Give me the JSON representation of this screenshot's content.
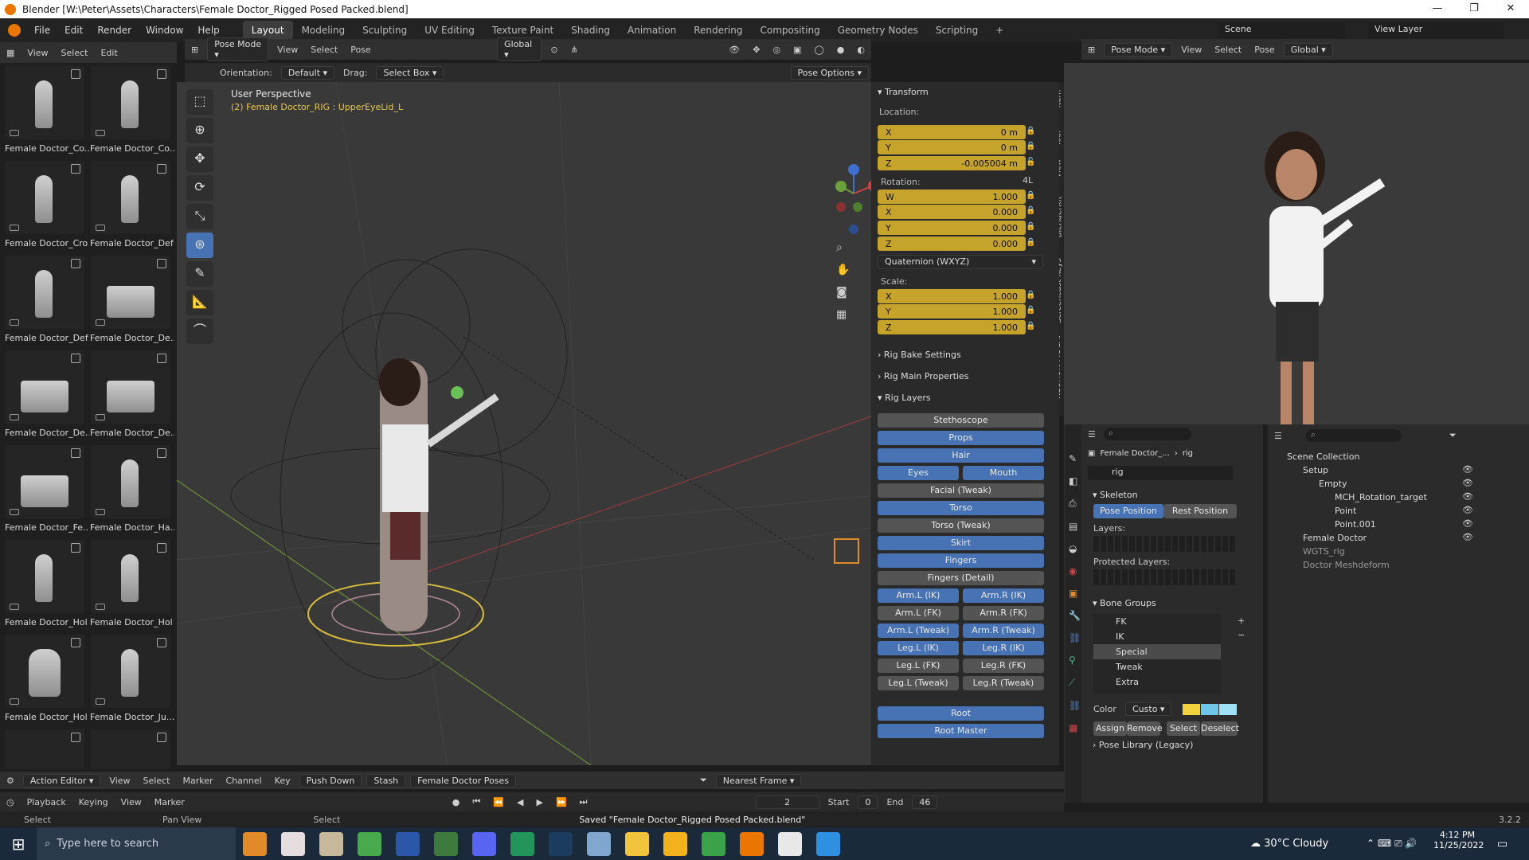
{
  "window": {
    "title": "Blender [W:\\Peter\\Assets\\Characters\\Female Doctor_Rigged Posed Packed.blend]"
  },
  "menu": [
    "File",
    "Edit",
    "Render",
    "Window",
    "Help"
  ],
  "workspaces": [
    "Layout",
    "Modeling",
    "Sculpting",
    "UV Editing",
    "Texture Paint",
    "Shading",
    "Animation",
    "Rendering",
    "Compositing",
    "Geometry Nodes",
    "Scripting"
  ],
  "scene": {
    "label": "Scene",
    "view_layer": "View Layer"
  },
  "asset_header": [
    "View",
    "Select",
    "Edit"
  ],
  "assets": [
    "Female Doctor_Co...",
    "Female Doctor_Co...",
    "Female Doctor_Cro",
    "Female Doctor_Def",
    "Female Doctor_Def",
    "Female Doctor_De...",
    "Female Doctor_De...",
    "Female Doctor_De...",
    "Female Doctor_Fe...",
    "Female Doctor_Ha...",
    "Female Doctor_Hol",
    "Female Doctor_Hol",
    "Female Doctor_Hol",
    "Female Doctor_Ju..."
  ],
  "viewport_header": {
    "mode": "Pose Mode",
    "items": [
      "View",
      "Select",
      "Pose"
    ],
    "orientation_global": "Global"
  },
  "tool_settings": {
    "orientation_label": "Orientation:",
    "orientation": "Default",
    "drag_label": "Drag:",
    "drag": "Select Box",
    "pose_options": "Pose Options"
  },
  "viewport": {
    "perspective": "User Perspective",
    "active": "(2) Female Doctor_RIG : UpperEyeLid_L"
  },
  "side_tabs": [
    "Item",
    "Tool",
    "View",
    "BlenderKit",
    "Screencast Keys",
    "NEURON MOCAP"
  ],
  "transform": {
    "title": "Transform",
    "location_label": "Location:",
    "loc": {
      "x": "0 m",
      "y": "0 m",
      "z": "-0.005004 m"
    },
    "rotation_label": "Rotation:",
    "rot_mode_badge": "4L",
    "rot": {
      "w": "1.000",
      "x": "0.000",
      "y": "0.000",
      "z": "0.000"
    },
    "rot_mode": "Quaternion (WXYZ)",
    "scale_label": "Scale:",
    "scale": {
      "x": "1.000",
      "y": "1.000",
      "z": "1.000"
    }
  },
  "panels": {
    "bake": "Rig Bake Settings",
    "main": "Rig Main Properties",
    "layers": "Rig Layers"
  },
  "rig_layers": [
    {
      "label": "Stethoscope",
      "on": false
    },
    {
      "label": "Props",
      "on": true
    },
    {
      "label": "Hair",
      "on": true
    },
    {
      "label": "Eyes",
      "on": true,
      "pair": "Mouth",
      "pair_on": true
    },
    {
      "label": "Facial (Tweak)",
      "on": false
    },
    {
      "label": "Torso",
      "on": true
    },
    {
      "label": "Torso (Tweak)",
      "on": false
    },
    {
      "label": "Skirt",
      "on": true
    },
    {
      "label": "Fingers",
      "on": true
    },
    {
      "label": "Fingers (Detail)",
      "on": false
    },
    {
      "label": "Arm.L (IK)",
      "on": true,
      "pair": "Arm.R (IK)",
      "pair_on": true
    },
    {
      "label": "Arm.L (FK)",
      "on": false,
      "pair": "Arm.R (FK)",
      "pair_on": false
    },
    {
      "label": "Arm.L (Tweak)",
      "on": true,
      "pair": "Arm.R (Tweak)",
      "pair_on": true
    },
    {
      "label": "Leg.L (IK)",
      "on": true,
      "pair": "Leg.R (IK)",
      "pair_on": true
    },
    {
      "label": "Leg.L (FK)",
      "on": false,
      "pair": "Leg.R (FK)",
      "pair_on": false
    },
    {
      "label": "Leg.L (Tweak)",
      "on": false,
      "pair": "Leg.R (Tweak)",
      "pair_on": false
    }
  ],
  "root": "Root",
  "root_master": "Root Master",
  "right_header": {
    "mode": "Pose Mode",
    "items": [
      "View",
      "Select",
      "Pose"
    ],
    "global": "Global"
  },
  "props": {
    "breadcrumb1": "Female Doctor_...",
    "breadcrumb2": "rig",
    "rig_name": "rig",
    "skeleton": "Skeleton",
    "pose_position": "Pose Position",
    "rest_position": "Rest Position",
    "layers": "Layers:",
    "protected": "Protected Layers:",
    "bone_groups": "Bone Groups",
    "groups": [
      "FK",
      "IK",
      "Special",
      "Tweak",
      "Extra"
    ],
    "selected_group": "Special",
    "color_label": "Color",
    "color_set": "Custo",
    "swatches": [
      "#f2d33f",
      "#6fc6e8",
      "#9fe2f5"
    ],
    "assign": "Assign",
    "remove": "Remove",
    "select": "Select",
    "deselect": "Deselect",
    "pose_library": "Pose Library (Legacy)"
  },
  "outliner": {
    "root": "Scene Collection",
    "rows": [
      "Setup",
      "Empty",
      "MCH_Rotation_target",
      "Point",
      "Point.001",
      "Female Doctor",
      "WGTS_rig",
      "Doctor Meshdeform"
    ]
  },
  "action_editor": {
    "mode": "Action Editor",
    "items": [
      "View",
      "Select",
      "Marker",
      "Channel",
      "Key"
    ],
    "push_down": "Push Down",
    "stash": "Stash",
    "action": "Female Doctor Poses",
    "snap": "Nearest Frame"
  },
  "timeline": {
    "items": [
      "Playback",
      "Keying",
      "View",
      "Marker"
    ],
    "frame": "2",
    "start_label": "Start",
    "start": "0",
    "end_label": "End",
    "end": "46"
  },
  "status": {
    "select": "Select",
    "pan": "Pan View",
    "select2": "Select",
    "message": "Saved \"Female Doctor_Rigged Posed Packed.blend\"",
    "version": "3.2.2"
  },
  "taskbar": {
    "search": "Type here to search",
    "weather": "30°C  Cloudy",
    "time": "4:12 PM",
    "date": "11/25/2022"
  }
}
